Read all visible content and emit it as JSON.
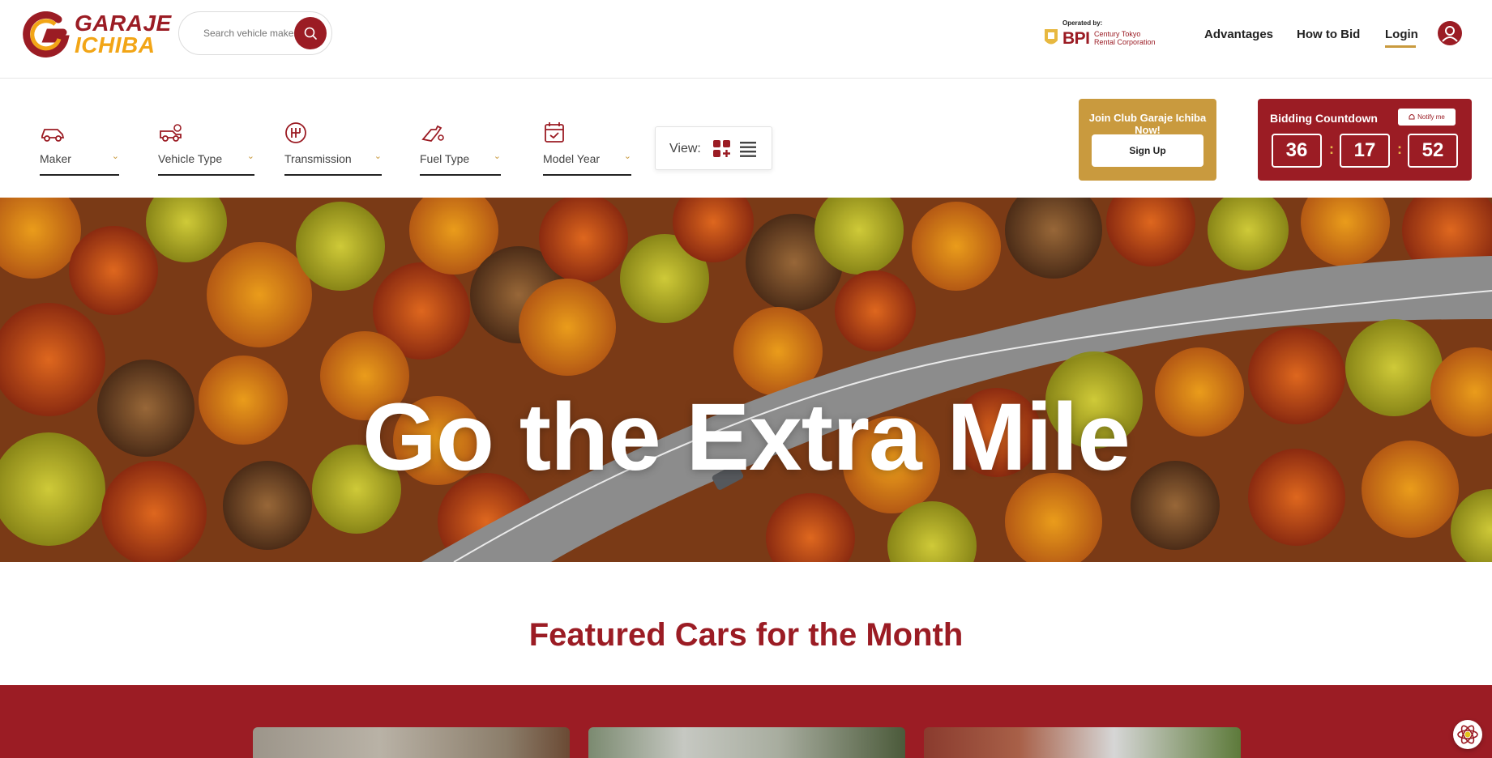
{
  "brand": {
    "line1": "GARAJE",
    "line2": "ICHIBA",
    "primary_color": "#9b1c24",
    "accent_color": "#f2a516",
    "gold_color": "#c99a3e"
  },
  "search": {
    "placeholder": "Search vehicle maker",
    "icon": "search-icon"
  },
  "operator": {
    "label": "Operated by:",
    "name": "BPI",
    "sub_line1": "Century Tokyo",
    "sub_line2": "Rental Corporation"
  },
  "nav": {
    "advantages": "Advantages",
    "how_to_bid": "How to Bid",
    "login": "Login",
    "account_icon": "user-icon"
  },
  "filters": [
    {
      "label": "Maker",
      "icon": "car-icon"
    },
    {
      "label": "Vehicle Type",
      "icon": "truck-icon"
    },
    {
      "label": "Transmission",
      "icon": "gear-shift-icon"
    },
    {
      "label": "Fuel Type",
      "icon": "fuel-nozzle-icon"
    },
    {
      "label": "Model Year",
      "icon": "calendar-icon"
    }
  ],
  "view": {
    "label": "View:",
    "grid_icon": "grid-icon",
    "list_icon": "list-icon"
  },
  "club": {
    "title": "Join Club Garaje Ichiba Now!",
    "button": "Sign Up"
  },
  "countdown": {
    "title": "Bidding Countdown",
    "notify": "Notify me",
    "values": [
      "36",
      "17",
      "52"
    ]
  },
  "hero": {
    "title": "Go the Extra Mile"
  },
  "featured": {
    "title": "Featured Cars for the Month"
  }
}
